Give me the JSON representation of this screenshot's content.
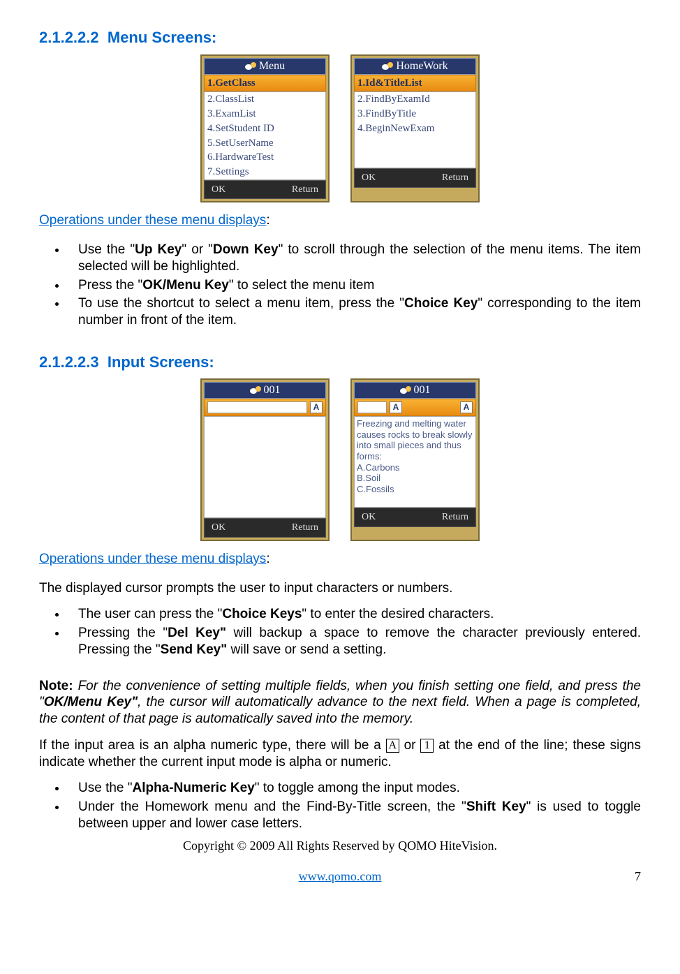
{
  "section1": {
    "number": "2.1.2.2.2",
    "title": "Menu Screens:"
  },
  "phoneMenu": {
    "title": "Menu",
    "selected": "1.GetClass",
    "items": [
      "2.ClassList",
      "3.ExamList",
      "4.SetStudent ID",
      "5.SetUserName",
      "6.HardwareTest",
      "7.Settings"
    ],
    "ok": "OK",
    "return": "Return"
  },
  "phoneHomework": {
    "title": "HomeWork",
    "selected": "1.Id&TitleList",
    "items": [
      "2.FindByExamId",
      "3.FindByTitle",
      "4.BeginNewExam"
    ],
    "ok": "OK",
    "return": "Return"
  },
  "ops1": {
    "link": "Operations under these menu displays",
    "colon": ":",
    "b1_pre": "Use the \"",
    "b1_k1": "Up Key",
    "b1_mid": "\" or \"",
    "b1_k2": "Down Key",
    "b1_post": "\" to scroll through the selection of the menu items. The item selected will be highlighted.",
    "b2_pre": "Press the \"",
    "b2_k": "OK/Menu Key",
    "b2_post": "\" to select the menu item",
    "b3_pre": "To use the shortcut to select a menu item, press the \"",
    "b3_k": "Choice Key",
    "b3_post": "\" corresponding to the item number in front of the item."
  },
  "section2": {
    "number": "2.1.2.2.3",
    "title": "Input Screens:"
  },
  "phoneInput1": {
    "title": "001",
    "mode": "A",
    "ok": "OK",
    "return": "Return"
  },
  "phoneInput2": {
    "title": "001",
    "modeA": "A",
    "mode": "A",
    "question": "Freezing and melting water causes rocks to break slowly into small pieces and thus forms:",
    "optA": "A.Carbons",
    "optB": "B.Soil",
    "optC": "C.Fossils",
    "ok": "OK",
    "return": "Return"
  },
  "ops2": {
    "link": "Operations under these menu displays",
    "colon": ":",
    "intro": "The displayed cursor prompts the user to input characters or numbers.",
    "b1_pre": "The user can press the \"",
    "b1_k": "Choice Keys",
    "b1_post": "\" to enter the desired characters.",
    "b2_pre": "Pressing the \"",
    "b2_k1": "Del Key\"",
    "b2_mid": " will backup a space to remove the character previously entered. Pressing the \"",
    "b2_k2": "Send Key\"",
    "b2_post": " will save or send a setting."
  },
  "note": {
    "label": "Note:",
    "t1": " For the convenience of setting multiple fields, when you finish setting one field, and press the \"",
    "key": "OK/Menu Key\"",
    "t2": ", the cursor will automatically advance to the next field. When a page is completed, the content of that page is automatically saved into the memory."
  },
  "alphaLine": {
    "pre": "If the input area is an alpha numeric type, there will be a ",
    "boxA": "A",
    "mid": " or  ",
    "box1": "1",
    "post": " at the end of the line; these signs indicate whether the current input mode is alpha or numeric."
  },
  "ops3": {
    "b1_pre": "Use the \"",
    "b1_k": "Alpha-Numeric Key",
    "b1_post": "\" to toggle among the input modes.",
    "b2_pre": "Under the Homework menu and the Find-By-Title screen, the \"",
    "b2_k": "Shift Key",
    "b2_post": "\" is used to toggle between upper and lower case letters."
  },
  "footer": {
    "copyright": "Copyright © 2009 All Rights Reserved by QOMO HiteVision.",
    "url": "www.qomo.com",
    "page": "7"
  }
}
